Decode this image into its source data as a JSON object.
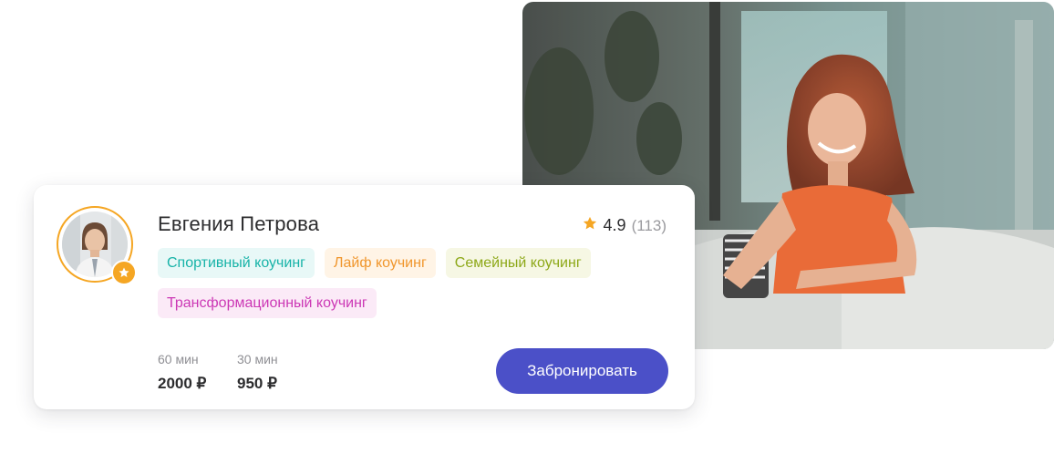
{
  "coach": {
    "name": "Евгения Петрова",
    "rating": "4.9",
    "reviews": "(113)",
    "tags": [
      "Спортивный коучинг",
      "Лайф коучинг",
      "Семейный коучинг",
      "Трансформационный коучинг"
    ],
    "prices": [
      {
        "duration": "60 мин",
        "price": "2000 ₽"
      },
      {
        "duration": "30 мин",
        "price": "950 ₽"
      }
    ],
    "book_label": "Забронировать"
  },
  "icons": {
    "rating_star": "star-icon",
    "avatar_badge": "star-badge-icon"
  },
  "colors": {
    "accent": "#4b50c8",
    "star": "#f5a623"
  }
}
